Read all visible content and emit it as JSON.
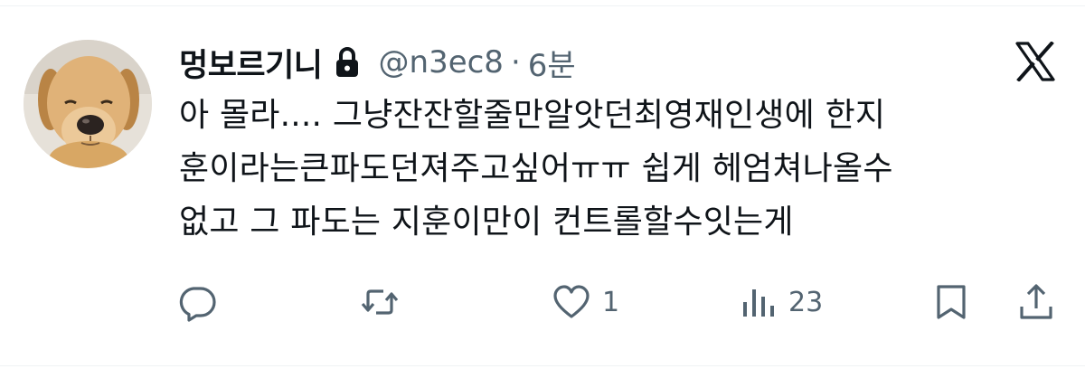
{
  "user": {
    "display_name": "멍보르기니",
    "handle": "@n3ec8",
    "separator": "·",
    "time": "6분",
    "protected_icon": "lock-icon",
    "avatar": "puppy-photo"
  },
  "brand_icon": "x-logo-icon",
  "tweet": {
    "text": "아 몰라.... 그냥잔잔할줄만알앗던최영재인생에 한지\n훈이라는큰파도던져주고싶어ㅠㅠ 쉽게 헤엄쳐나올수\n없고 그 파도는 지훈이만이 컨트롤할수잇는게"
  },
  "actions": {
    "reply_icon": "reply-icon",
    "retweet_icon": "retweet-icon",
    "like_icon": "heart-icon",
    "like_count": "1",
    "views_icon": "views-icon",
    "views_count": "23",
    "bookmark_icon": "bookmark-icon",
    "share_icon": "share-icon"
  },
  "colors": {
    "text": "#0f1419",
    "secondary": "#536471",
    "divider": "#eff3f4"
  }
}
